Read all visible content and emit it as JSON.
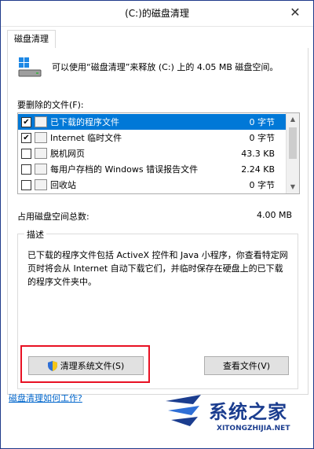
{
  "window": {
    "title": "(C:)的磁盘清理",
    "close_glyph": "✕"
  },
  "tab": {
    "label": "磁盘清理"
  },
  "summary": "可以使用“磁盘清理”来释放 (C:) 上的 4.05 MB 磁盘空间。",
  "files_label": "要删除的文件(F):",
  "files": [
    {
      "checked": true,
      "name": "已下载的程序文件",
      "size": "0 字节",
      "selected": true
    },
    {
      "checked": true,
      "name": "Internet 临时文件",
      "size": "0 字节",
      "selected": false
    },
    {
      "checked": false,
      "name": "脱机网页",
      "size": "43.3 KB",
      "selected": false
    },
    {
      "checked": false,
      "name": "每用户存档的 Windows 错误报告文件",
      "size": "2.24 KB",
      "selected": false
    },
    {
      "checked": false,
      "name": "回收站",
      "size": "0 字节",
      "selected": false
    }
  ],
  "total": {
    "label": "占用磁盘空间总数:",
    "value": "4.00 MB"
  },
  "description": {
    "legend": "描述",
    "text": "已下载的程序文件包括 ActiveX 控件和 Java 小程序，你查看特定网页时将会从 Internet 自动下载它们，并临时保存在硬盘上的已下载的程序文件夹中。"
  },
  "buttons": {
    "cleanup_system": "清理系统文件(S)",
    "view_files": "查看文件(V)"
  },
  "help_link": "磁盘清理如何工作?",
  "watermark": {
    "name": "系统之家",
    "url": "XITONGZHIJIA.NET"
  },
  "colors": {
    "selection": "#0078d7",
    "highlight": "#e81123",
    "link": "#0066cc"
  }
}
